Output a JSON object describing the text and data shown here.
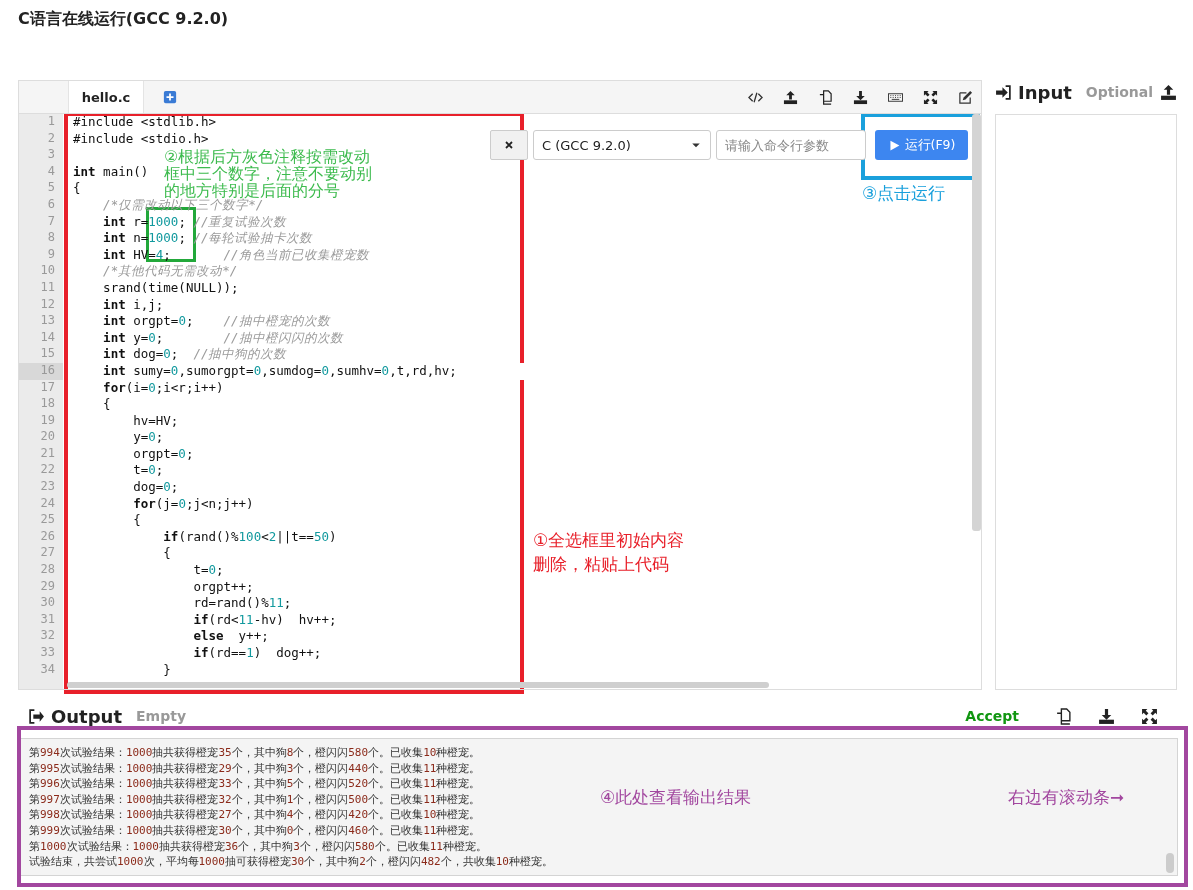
{
  "page_title": "C语言在线运行(GCC 9.2.0)",
  "editor": {
    "tabs": [
      {
        "label": "hello.c",
        "selected": true
      }
    ],
    "run_bar": {
      "language": "C (GCC 9.2.0)",
      "args_placeholder": "请输入命令行参数",
      "run_button": "运行(F9)"
    },
    "lines": [
      {
        "number": "1",
        "code": "#include <stdlib.h>",
        "active": false
      },
      {
        "number": "2",
        "code": "#include <stdio.h>",
        "active": false
      },
      {
        "number": "3",
        "active": false
      },
      {
        "number": "4",
        "code": "int main()",
        "active": false
      },
      {
        "number": "5",
        "code": "{",
        "active": false
      },
      {
        "number": "6",
        "code": "    /*仅需改动以下三个数字*/",
        "active": false
      },
      {
        "number": "7",
        "code": "    int r=1000; //重复试验次数",
        "active": false
      },
      {
        "number": "8",
        "code": "    int n=1000; //每轮试验抽卡次数",
        "active": false
      },
      {
        "number": "9",
        "code": "    int HV=4;       //角色当前已收集橙宠数",
        "active": false
      },
      {
        "number": "10",
        "code": "    /*其他代码无需改动*/",
        "active": false
      },
      {
        "number": "11",
        "code": "    srand(time(NULL));",
        "active": false
      },
      {
        "number": "12",
        "code": "    int i,j;",
        "active": false
      },
      {
        "number": "13",
        "code": "    int orgpt=0;    //抽中橙宠的次数",
        "active": false
      },
      {
        "number": "14",
        "code": "    int y=0;        //抽中橙闪闪的次数",
        "active": false
      },
      {
        "number": "15",
        "code": "    int dog=0;  //抽中狗的次数",
        "active": false
      },
      {
        "number": "16",
        "code": "    int sumy=0,sumorgpt=0,sumdog=0,sumhv=0,t,rd,hv;",
        "active": true
      },
      {
        "number": "17",
        "code": "    for(i=0;i<r;i++)",
        "active": false
      },
      {
        "number": "18",
        "code": "    {",
        "active": false
      },
      {
        "number": "19",
        "code": "        hv=HV;",
        "active": false
      },
      {
        "number": "20",
        "code": "        y=0;",
        "active": false
      },
      {
        "number": "21",
        "code": "        orgpt=0;",
        "active": false
      },
      {
        "number": "22",
        "code": "        t=0;",
        "active": false
      },
      {
        "number": "23",
        "code": "        dog=0;",
        "active": false
      },
      {
        "number": "24",
        "code": "        for(j=0;j<n;j++)",
        "active": false
      },
      {
        "number": "25",
        "code": "        {",
        "active": false
      },
      {
        "number": "26",
        "code": "            if(rand()%100<2||t==50)",
        "active": false
      },
      {
        "number": "27",
        "code": "            {",
        "active": false
      },
      {
        "number": "28",
        "code": "                t=0;",
        "active": false
      },
      {
        "number": "29",
        "code": "                orgpt++;",
        "active": false
      },
      {
        "number": "30",
        "code": "                rd=rand()%11;",
        "active": false
      },
      {
        "number": "31",
        "code": "                if(rd<11-hv)  hv++;",
        "active": false
      },
      {
        "number": "32",
        "code": "                else  y++;",
        "active": false
      },
      {
        "number": "33",
        "code": "                if(rd==1)  dog++;",
        "active": false
      },
      {
        "number": "34",
        "code": "            }",
        "active": false
      }
    ]
  },
  "input_panel": {
    "title": "Input",
    "hint": "Optional"
  },
  "output_panel": {
    "title": "Output",
    "state": "Empty",
    "verdict": "Accept",
    "lines": [
      "第994次试验结果：1000抽共获得橙宠35个，其中狗8个，橙闪闪580个。已收集10种橙宠。",
      "第995次试验结果：1000抽共获得橙宠29个，其中狗3个，橙闪闪440个。已收集11种橙宠。",
      "第996次试验结果：1000抽共获得橙宠33个，其中狗5个，橙闪闪520个。已收集11种橙宠。",
      "第997次试验结果：1000抽共获得橙宠32个，其中狗1个，橙闪闪500个。已收集11种橙宠。",
      "第998次试验结果：1000抽共获得橙宠27个，其中狗4个，橙闪闪420个。已收集10种橙宠。",
      "第999次试验结果：1000抽共获得橙宠30个，其中狗0个，橙闪闪460个。已收集11种橙宠。",
      "第1000次试验结果：1000抽共获得橙宠36个，其中狗3个，橙闪闪580个。已收集11种橙宠。",
      "试验结束，共尝试1000次，平均每1000抽可获得橙宠30个，其中狗2个，橙闪闪482个，共收集10种橙宠。"
    ]
  },
  "annotations": [
    {
      "kind": "frame",
      "color": "#e8202a"
    },
    {
      "kind": "frame",
      "color": "#22a83a"
    },
    {
      "kind": "frame",
      "color": "#1aa0dc"
    },
    {
      "kind": "frame",
      "color": "#a2479f"
    },
    {
      "kind": "note",
      "lines": [
        "②根据后方灰色注释按需改动",
        "框中三个数字，注意不要动别",
        "的地方特别是后面的分号"
      ],
      "color": "#3dbb4e"
    },
    {
      "kind": "note",
      "lines": [
        "③点击运行"
      ],
      "color": "#1aa0dc"
    },
    {
      "kind": "note",
      "lines": [
        "①全选框里初始内容",
        "删除，粘贴上代码"
      ],
      "color": "#e8202a"
    },
    {
      "kind": "note",
      "lines": [
        "④此处查看输出结果"
      ],
      "color": "#a2479f"
    },
    {
      "kind": "note",
      "lines": [
        "右边有滚动条➞"
      ],
      "color": "#a2479f"
    }
  ]
}
